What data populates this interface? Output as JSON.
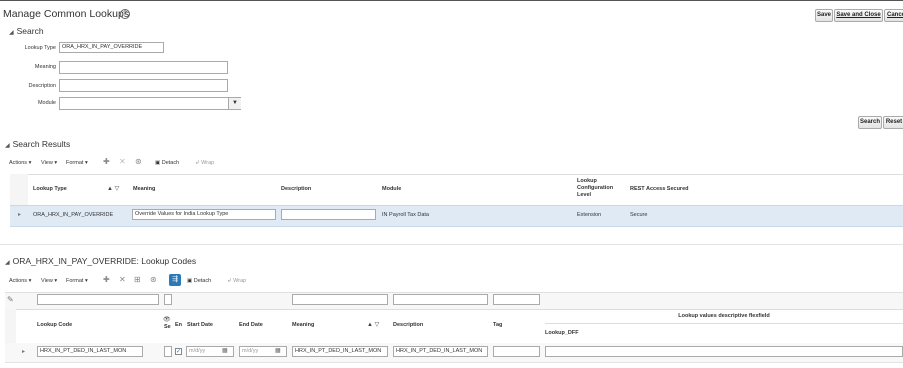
{
  "page": {
    "title": "Manage Common Lookups",
    "help_icon": "?"
  },
  "top_buttons": {
    "save": "Save",
    "save_close": "Save and Close",
    "cancel": "Cance"
  },
  "search": {
    "header": "Search",
    "lookup_type_label": "Lookup Type",
    "lookup_type_value": "ORA_HRX_IN_PAY_OVERRIDE",
    "meaning_label": "Meaning",
    "meaning_value": "",
    "description_label": "Description",
    "description_value": "",
    "module_label": "Module",
    "module_value": "",
    "search_button": "Search",
    "reset_button": "Reset"
  },
  "results": {
    "header": "Search Results",
    "toolbar": {
      "actions": "Actions",
      "view": "View",
      "format": "Format",
      "detach": "Detach",
      "wrap": "Wrap"
    },
    "columns": {
      "lookup_type": "Lookup Type",
      "meaning": "Meaning",
      "description": "Description",
      "module": "Module",
      "config_level": "Lookup Configuration Level",
      "rest": "REST Access Secured"
    },
    "row": {
      "lookup_type": "ORA_HRX_IN_PAY_OVERRIDE",
      "meaning": "Override Values for India Lookup Type",
      "description": "",
      "module": "IN Payroll Tax Data",
      "config_level": "Extension",
      "rest": "Secure"
    }
  },
  "codes": {
    "header": "ORA_HRX_IN_PAY_OVERRIDE: Lookup Codes",
    "toolbar": {
      "actions": "Actions",
      "view": "View",
      "format": "Format",
      "detach": "Detach",
      "wrap": "Wrap"
    },
    "columns": {
      "lookup_code": "Lookup Code",
      "seq": "Se",
      "enabled": "En",
      "start_date": "Start Date",
      "end_date": "End Date",
      "meaning": "Meaning",
      "description": "Description",
      "tag": "Tag",
      "dff_group": "Lookup values descriptive flexfield",
      "dff": "Lookup_DFF"
    },
    "row": {
      "lookup_code": "HRX_IN_PT_DED_IN_LAST_MON",
      "seq": "",
      "start_date_placeholder": "m/d/yy",
      "end_date_placeholder": "m/d/yy",
      "meaning": "HRX_IN_PT_DED_IN_LAST_MON",
      "description": "HRX_IN_PT_DED_IN_LAST_MON",
      "tag": "",
      "dff": ""
    }
  },
  "colors": {
    "selected_row": "#dfeaf5",
    "accent_blue": "#2a7ab8"
  }
}
